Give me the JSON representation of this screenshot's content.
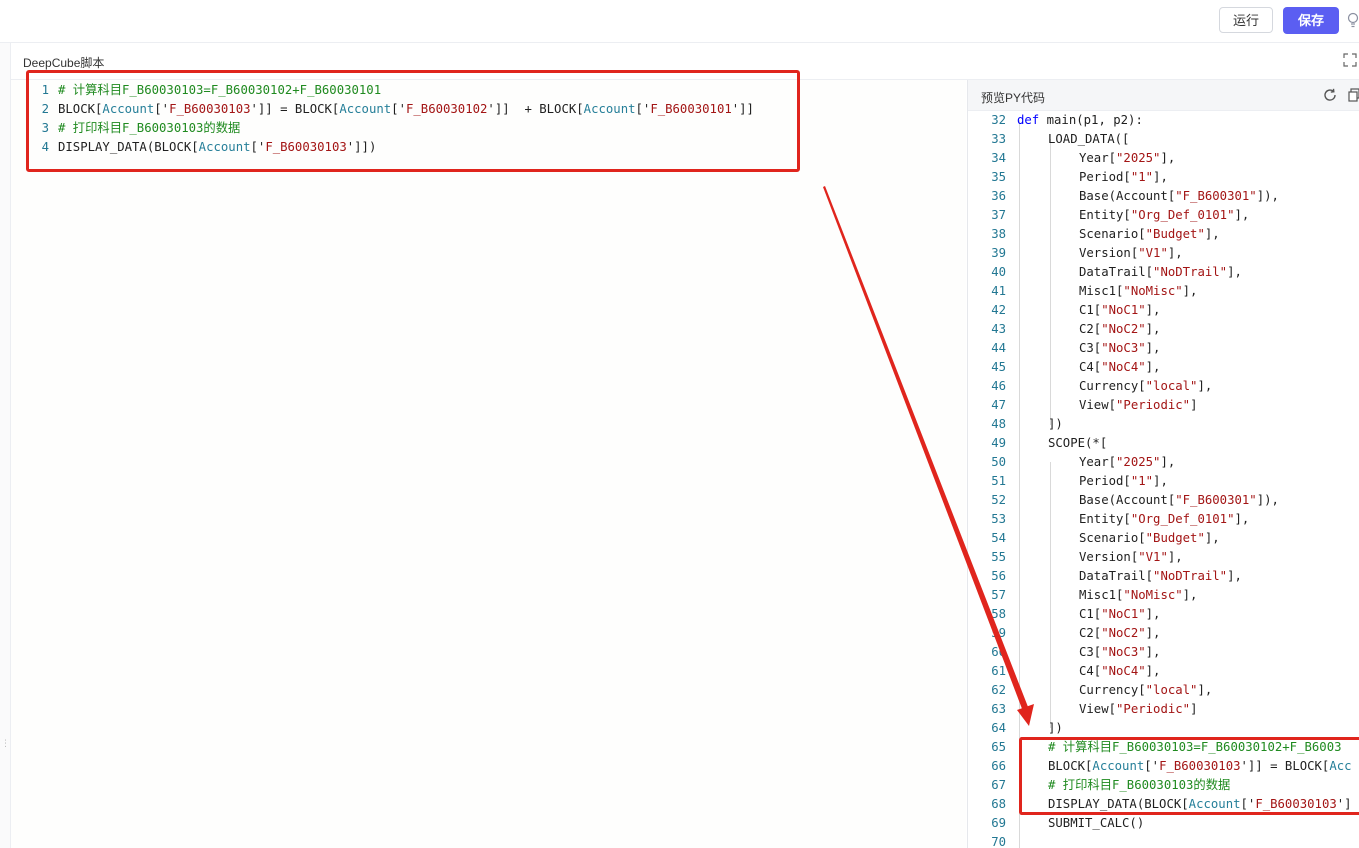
{
  "toolbar": {
    "run_label": "运行",
    "save_label": "保存"
  },
  "script": {
    "title": "DeepCube脚本"
  },
  "left_code": [
    {
      "num": "1",
      "parts": [
        {
          "t": "# 计算科目F_B60030103=F_B60030102+F_B60030101",
          "c": "com"
        }
      ]
    },
    {
      "num": "2",
      "parts": [
        {
          "t": "BLOCK[",
          "c": ""
        },
        {
          "t": "Account",
          "c": "acc"
        },
        {
          "t": "['",
          "c": ""
        },
        {
          "t": "F_B60030103",
          "c": "str"
        },
        {
          "t": "']] = BLOCK[",
          "c": ""
        },
        {
          "t": "Account",
          "c": "acc"
        },
        {
          "t": "['",
          "c": ""
        },
        {
          "t": "F_B60030102",
          "c": "str"
        },
        {
          "t": "']]  + BLOCK[",
          "c": ""
        },
        {
          "t": "Account",
          "c": "acc"
        },
        {
          "t": "['",
          "c": ""
        },
        {
          "t": "F_B60030101",
          "c": "str"
        },
        {
          "t": "']]",
          "c": ""
        }
      ]
    },
    {
      "num": "3",
      "parts": [
        {
          "t": "# 打印科目F_B60030103的数据",
          "c": "com"
        }
      ]
    },
    {
      "num": "4",
      "parts": [
        {
          "t": "DISPLAY_DATA(BLOCK[",
          "c": ""
        },
        {
          "t": "Account",
          "c": "acc"
        },
        {
          "t": "['",
          "c": ""
        },
        {
          "t": "F_B60030103",
          "c": "str"
        },
        {
          "t": "']])",
          "c": ""
        }
      ]
    }
  ],
  "preview": {
    "title": "预览PY代码",
    "lines": [
      {
        "num": "32",
        "indent": 0,
        "parts": [
          {
            "t": "def",
            "c": "def"
          },
          {
            "t": " main(p1, p2):",
            "c": ""
          }
        ]
      },
      {
        "num": "33",
        "indent": 1,
        "parts": [
          {
            "t": "LOAD_DATA([",
            "c": ""
          }
        ]
      },
      {
        "num": "34",
        "indent": 2,
        "parts": [
          {
            "t": "Year[",
            "c": ""
          },
          {
            "t": "\"2025\"",
            "c": "str"
          },
          {
            "t": "],",
            "c": ""
          }
        ]
      },
      {
        "num": "35",
        "indent": 2,
        "parts": [
          {
            "t": "Period[",
            "c": ""
          },
          {
            "t": "\"1\"",
            "c": "str"
          },
          {
            "t": "],",
            "c": ""
          }
        ]
      },
      {
        "num": "36",
        "indent": 2,
        "parts": [
          {
            "t": "Base(Account[",
            "c": ""
          },
          {
            "t": "\"F_B600301\"",
            "c": "str"
          },
          {
            "t": "]),",
            "c": ""
          }
        ]
      },
      {
        "num": "37",
        "indent": 2,
        "parts": [
          {
            "t": "Entity[",
            "c": ""
          },
          {
            "t": "\"Org_Def_0101\"",
            "c": "str"
          },
          {
            "t": "],",
            "c": ""
          }
        ]
      },
      {
        "num": "38",
        "indent": 2,
        "parts": [
          {
            "t": "Scenario[",
            "c": ""
          },
          {
            "t": "\"Budget\"",
            "c": "str"
          },
          {
            "t": "],",
            "c": ""
          }
        ]
      },
      {
        "num": "39",
        "indent": 2,
        "parts": [
          {
            "t": "Version[",
            "c": ""
          },
          {
            "t": "\"V1\"",
            "c": "str"
          },
          {
            "t": "],",
            "c": ""
          }
        ]
      },
      {
        "num": "40",
        "indent": 2,
        "parts": [
          {
            "t": "DataTrail[",
            "c": ""
          },
          {
            "t": "\"NoDTrail\"",
            "c": "str"
          },
          {
            "t": "],",
            "c": ""
          }
        ]
      },
      {
        "num": "41",
        "indent": 2,
        "parts": [
          {
            "t": "Misc1[",
            "c": ""
          },
          {
            "t": "\"NoMisc\"",
            "c": "str"
          },
          {
            "t": "],",
            "c": ""
          }
        ]
      },
      {
        "num": "42",
        "indent": 2,
        "parts": [
          {
            "t": "C1[",
            "c": ""
          },
          {
            "t": "\"NoC1\"",
            "c": "str"
          },
          {
            "t": "],",
            "c": ""
          }
        ]
      },
      {
        "num": "43",
        "indent": 2,
        "parts": [
          {
            "t": "C2[",
            "c": ""
          },
          {
            "t": "\"NoC2\"",
            "c": "str"
          },
          {
            "t": "],",
            "c": ""
          }
        ]
      },
      {
        "num": "44",
        "indent": 2,
        "parts": [
          {
            "t": "C3[",
            "c": ""
          },
          {
            "t": "\"NoC3\"",
            "c": "str"
          },
          {
            "t": "],",
            "c": ""
          }
        ]
      },
      {
        "num": "45",
        "indent": 2,
        "parts": [
          {
            "t": "C4[",
            "c": ""
          },
          {
            "t": "\"NoC4\"",
            "c": "str"
          },
          {
            "t": "],",
            "c": ""
          }
        ]
      },
      {
        "num": "46",
        "indent": 2,
        "parts": [
          {
            "t": "Currency[",
            "c": ""
          },
          {
            "t": "\"local\"",
            "c": "str"
          },
          {
            "t": "],",
            "c": ""
          }
        ]
      },
      {
        "num": "47",
        "indent": 2,
        "parts": [
          {
            "t": "View[",
            "c": ""
          },
          {
            "t": "\"Periodic\"",
            "c": "str"
          },
          {
            "t": "]",
            "c": ""
          }
        ]
      },
      {
        "num": "48",
        "indent": 1,
        "parts": [
          {
            "t": "])",
            "c": ""
          }
        ]
      },
      {
        "num": "49",
        "indent": 1,
        "parts": [
          {
            "t": "SCOPE(*[",
            "c": ""
          }
        ]
      },
      {
        "num": "50",
        "indent": 2,
        "parts": [
          {
            "t": "Year[",
            "c": ""
          },
          {
            "t": "\"2025\"",
            "c": "str"
          },
          {
            "t": "],",
            "c": ""
          }
        ]
      },
      {
        "num": "51",
        "indent": 2,
        "parts": [
          {
            "t": "Period[",
            "c": ""
          },
          {
            "t": "\"1\"",
            "c": "str"
          },
          {
            "t": "],",
            "c": ""
          }
        ]
      },
      {
        "num": "52",
        "indent": 2,
        "parts": [
          {
            "t": "Base(Account[",
            "c": ""
          },
          {
            "t": "\"F_B600301\"",
            "c": "str"
          },
          {
            "t": "]),",
            "c": ""
          }
        ]
      },
      {
        "num": "53",
        "indent": 2,
        "parts": [
          {
            "t": "Entity[",
            "c": ""
          },
          {
            "t": "\"Org_Def_0101\"",
            "c": "str"
          },
          {
            "t": "],",
            "c": ""
          }
        ]
      },
      {
        "num": "54",
        "indent": 2,
        "parts": [
          {
            "t": "Scenario[",
            "c": ""
          },
          {
            "t": "\"Budget\"",
            "c": "str"
          },
          {
            "t": "],",
            "c": ""
          }
        ]
      },
      {
        "num": "55",
        "indent": 2,
        "parts": [
          {
            "t": "Version[",
            "c": ""
          },
          {
            "t": "\"V1\"",
            "c": "str"
          },
          {
            "t": "],",
            "c": ""
          }
        ]
      },
      {
        "num": "56",
        "indent": 2,
        "parts": [
          {
            "t": "DataTrail[",
            "c": ""
          },
          {
            "t": "\"NoDTrail\"",
            "c": "str"
          },
          {
            "t": "],",
            "c": ""
          }
        ]
      },
      {
        "num": "57",
        "indent": 2,
        "parts": [
          {
            "t": "Misc1[",
            "c": ""
          },
          {
            "t": "\"NoMisc\"",
            "c": "str"
          },
          {
            "t": "],",
            "c": ""
          }
        ]
      },
      {
        "num": "58",
        "indent": 2,
        "parts": [
          {
            "t": "C1[",
            "c": ""
          },
          {
            "t": "\"NoC1\"",
            "c": "str"
          },
          {
            "t": "],",
            "c": ""
          }
        ]
      },
      {
        "num": "59",
        "indent": 2,
        "parts": [
          {
            "t": "C2[",
            "c": ""
          },
          {
            "t": "\"NoC2\"",
            "c": "str"
          },
          {
            "t": "],",
            "c": ""
          }
        ]
      },
      {
        "num": "60",
        "indent": 2,
        "parts": [
          {
            "t": "C3[",
            "c": ""
          },
          {
            "t": "\"NoC3\"",
            "c": "str"
          },
          {
            "t": "],",
            "c": ""
          }
        ]
      },
      {
        "num": "61",
        "indent": 2,
        "parts": [
          {
            "t": "C4[",
            "c": ""
          },
          {
            "t": "\"NoC4\"",
            "c": "str"
          },
          {
            "t": "],",
            "c": ""
          }
        ]
      },
      {
        "num": "62",
        "indent": 2,
        "parts": [
          {
            "t": "Currency[",
            "c": ""
          },
          {
            "t": "\"local\"",
            "c": "str"
          },
          {
            "t": "],",
            "c": ""
          }
        ]
      },
      {
        "num": "63",
        "indent": 2,
        "parts": [
          {
            "t": "View[",
            "c": ""
          },
          {
            "t": "\"Periodic\"",
            "c": "str"
          },
          {
            "t": "]",
            "c": ""
          }
        ]
      },
      {
        "num": "64",
        "indent": 1,
        "parts": [
          {
            "t": "])",
            "c": ""
          }
        ]
      },
      {
        "num": "65",
        "indent": 1,
        "parts": [
          {
            "t": "# 计算科目F_B60030103=F_B60030102+F_B6003",
            "c": "com"
          }
        ]
      },
      {
        "num": "66",
        "indent": 1,
        "parts": [
          {
            "t": "BLOCK[",
            "c": ""
          },
          {
            "t": "Account",
            "c": "acc"
          },
          {
            "t": "['",
            "c": ""
          },
          {
            "t": "F_B60030103",
            "c": "str"
          },
          {
            "t": "']] = BLOCK[",
            "c": ""
          },
          {
            "t": "Acc",
            "c": "acc"
          }
        ]
      },
      {
        "num": "67",
        "indent": 1,
        "parts": [
          {
            "t": "# 打印科目F_B60030103的数据",
            "c": "com"
          }
        ]
      },
      {
        "num": "68",
        "indent": 1,
        "parts": [
          {
            "t": "DISPLAY_DATA(BLOCK[",
            "c": ""
          },
          {
            "t": "Account",
            "c": "acc"
          },
          {
            "t": "['",
            "c": ""
          },
          {
            "t": "F_B60030103",
            "c": "str"
          },
          {
            "t": "']",
            "c": ""
          }
        ]
      },
      {
        "num": "69",
        "indent": 1,
        "parts": [
          {
            "t": "SUBMIT_CALC()",
            "c": ""
          }
        ]
      },
      {
        "num": "70",
        "indent": 0,
        "parts": []
      }
    ]
  },
  "colors": {
    "accent": "#5b5ef2",
    "annotation_red": "#e0251d",
    "comment_green": "#1f8a1f",
    "string_red": "#a31515",
    "account_teal": "#267f99",
    "keyword_blue": "#0000ff",
    "line_number": "#237893"
  },
  "icons": [
    "bulb-icon",
    "expand-icon",
    "refresh-icon",
    "copy-icon",
    "arrow-annotation"
  ]
}
